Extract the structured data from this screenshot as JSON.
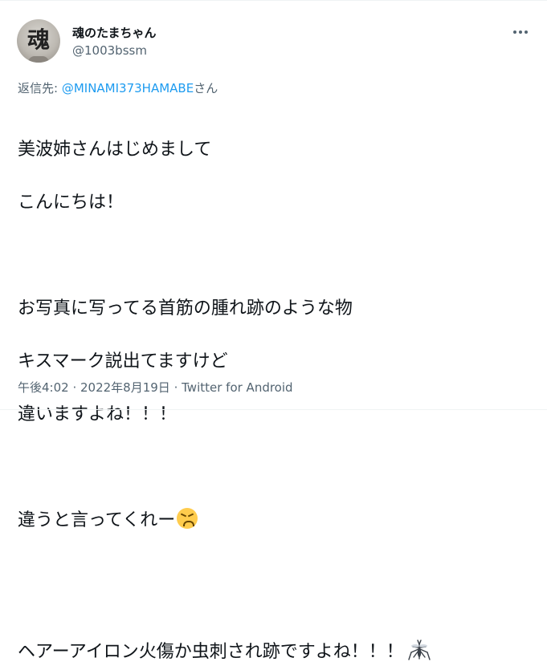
{
  "author": {
    "display_name": "魂のたまちゃん",
    "handle": "@1003bssm",
    "avatar_kanji": "魂"
  },
  "reply": {
    "prefix": "返信先: ",
    "mention": "@MINAMI373HAMABE",
    "suffix": "さん"
  },
  "tweet": {
    "lines": [
      "美波姉さんはじめまして",
      "こんにちは！",
      "",
      "お写真に写ってる首筋の腫れ跡のような物",
      "キスマーク説出てますけど",
      "違いますよね！！！",
      "",
      "違うと言ってくれー",
      "",
      "ヘアーアイロン火傷か虫刺され跡ですよね！！！"
    ],
    "emoji_line8": "tired-face",
    "emoji_line10": "mosquito"
  },
  "meta": {
    "time": "午後4:02",
    "sep1": " · ",
    "date": "2022年8月19日",
    "sep2": " · ",
    "source": "Twitter for Android"
  },
  "icons": {
    "more": "more-horizontal-icon"
  }
}
